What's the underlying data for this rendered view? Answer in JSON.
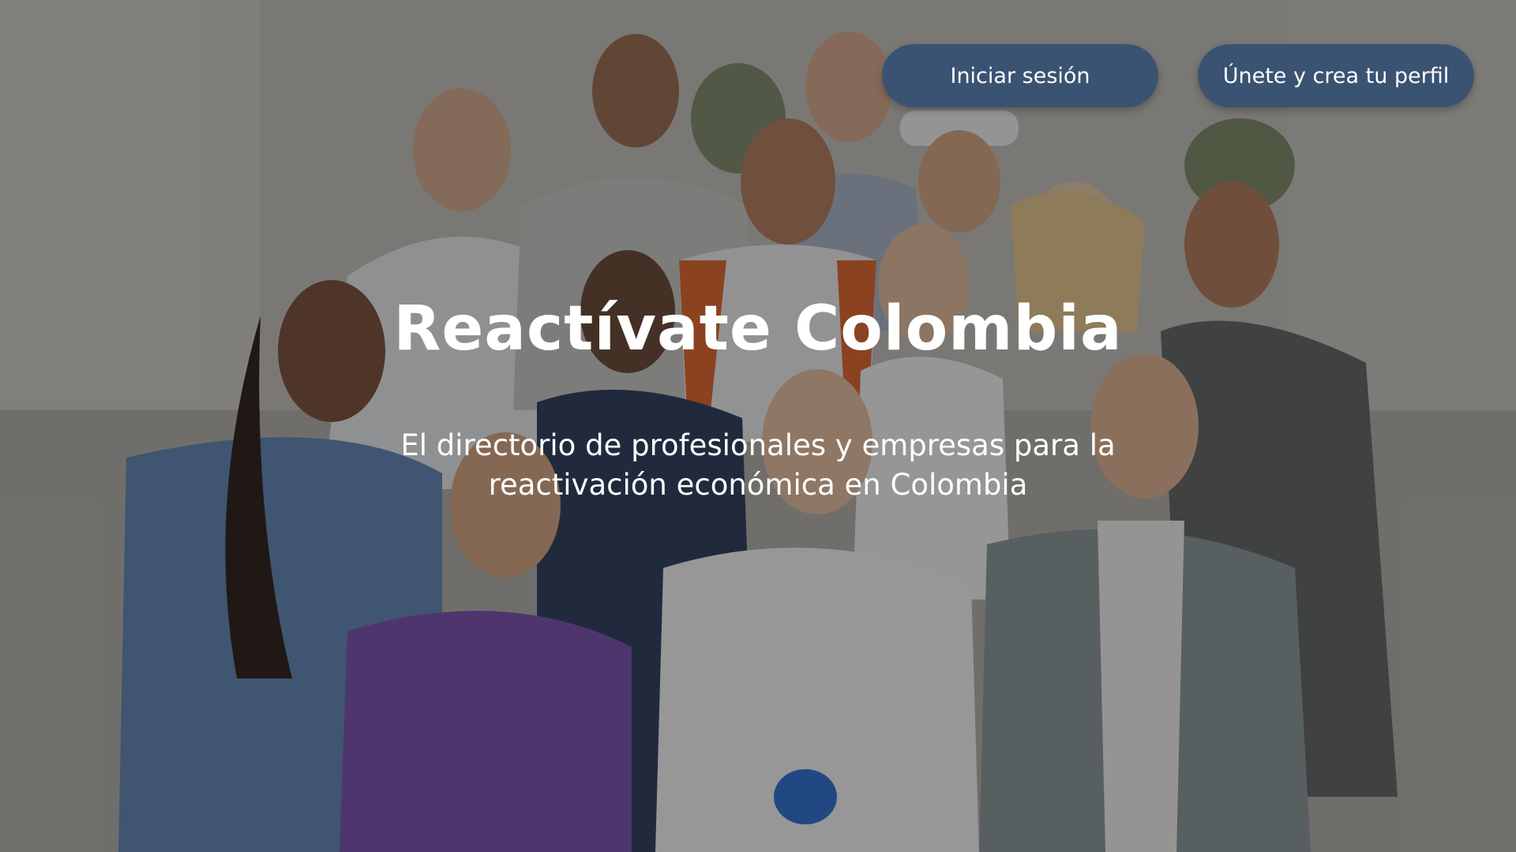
{
  "header": {
    "login_label": "Iniciar sesión",
    "signup_label": "Únete y crea tu perfil"
  },
  "hero": {
    "title": "Reactívate Colombia",
    "subtitle": "El directorio de profesionales y empresas para la reactivación económica en Colombia",
    "background_image": "group-of-diverse-professionals-photo"
  },
  "colors": {
    "button_bg": "#3b5373",
    "text": "#ffffff"
  }
}
